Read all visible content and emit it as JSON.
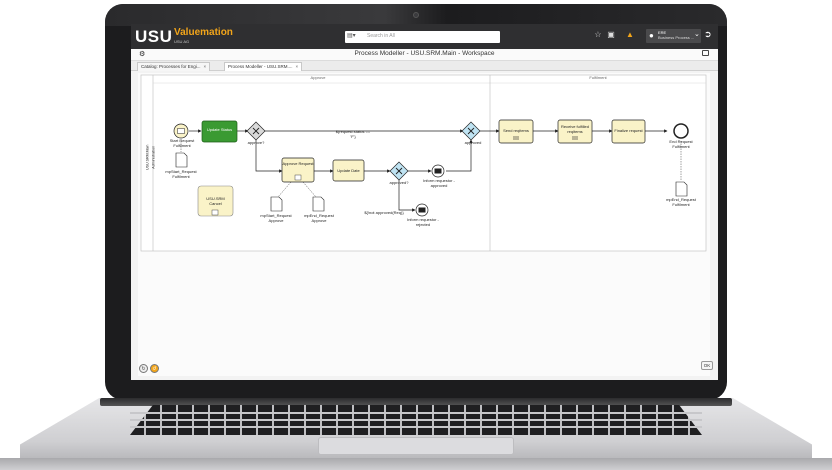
{
  "header": {
    "logo": "USU",
    "brand": "Valuemation",
    "brand_sub": "USU AG",
    "search_placeholder": "Search in All",
    "user_name": "ERE",
    "user_role": "Business Process ..."
  },
  "titlebar": {
    "title": "Process Modeller - USU.SRM.Main - Workspace"
  },
  "tabs": [
    {
      "label": "Catalog: Processes for Engi..."
    },
    {
      "label": "Process Modeller - USU.SRM...."
    }
  ],
  "diagram": {
    "lane_labels": [
      "USU.SRM.Main",
      "Administration"
    ],
    "phase_labels": [
      "Approve",
      "Fulfilment"
    ],
    "nodes": {
      "start_event": "Start Request Fulfilment",
      "data_start": "mpStart_Request Fulfilment",
      "update_status": "Update Status",
      "gw_approve": "approve?",
      "approve_request": "Approve Request",
      "update_date": "Update Date",
      "gw_approved": "approved?",
      "inform_approved": "Inform requestor - approved",
      "inform_rejected": "Inform requestor - rejected",
      "not_approved": "${!not approved(Req)}",
      "data_start_approve": "mpStart_Request Approve",
      "data_end_approve": "mpEnd_Request Approve",
      "cancel": "USU.SRM Cancel",
      "request_status": "${request.status == 'F'}",
      "gw_join": "approved",
      "send_reqitems": "Send reqitems",
      "receive_reqitems": "Receive fulfilled reqitems",
      "finalize_request": "Finalize request",
      "end_event": "End Request Fulfilment",
      "data_end": "mpEnd_Request Fulfilment"
    }
  },
  "footer": {
    "ok_label": "OK"
  },
  "colors": {
    "accent": "#f2a51a",
    "task_fill": "#faf3c8",
    "task_active": "#3a9a32",
    "gateway_fill": "#bfe3f2"
  }
}
